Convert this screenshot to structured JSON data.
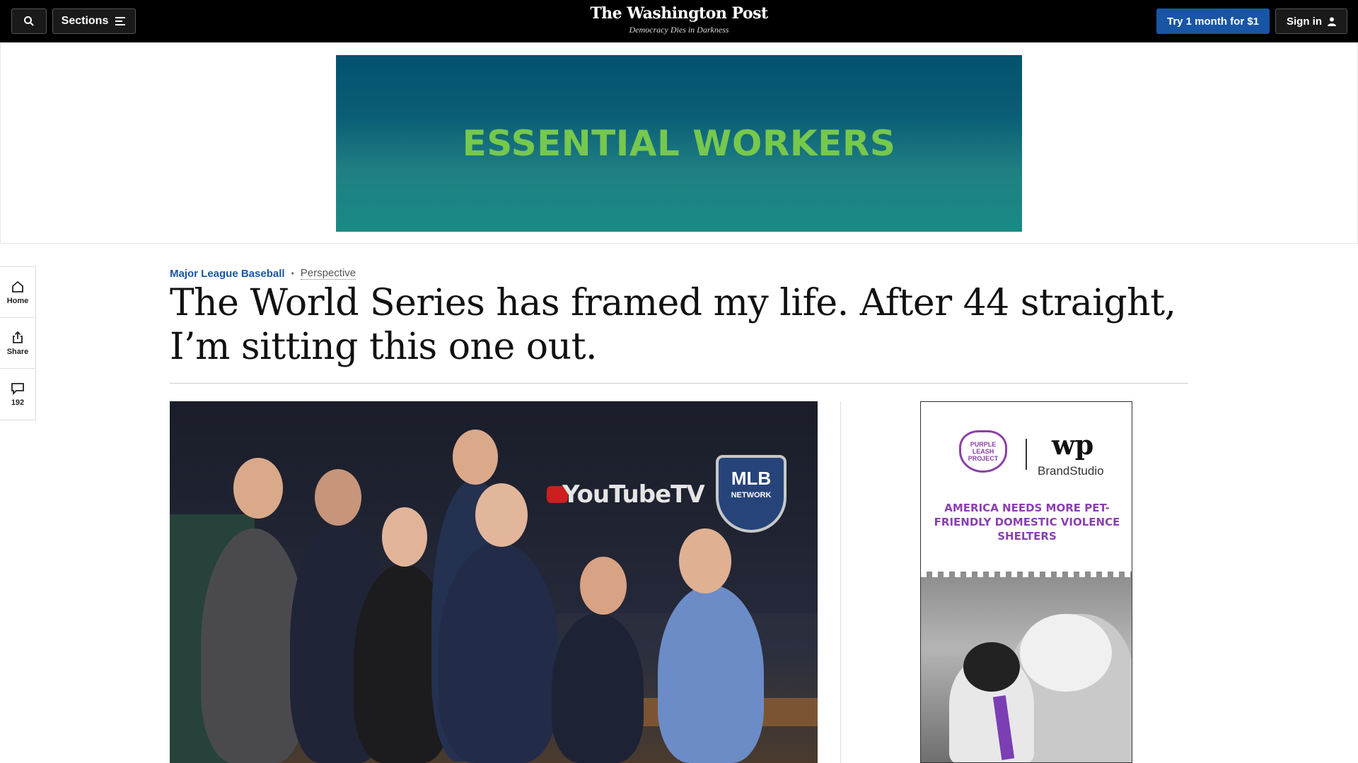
{
  "header": {
    "sections_label": "Sections",
    "logo_name": "The Washington Post",
    "logo_tagline": "Democracy Dies in Darkness",
    "try_label": "Try 1 month for $1",
    "signin_label": "Sign in"
  },
  "top_ad": {
    "headline": "ESSENTIAL WORKERS"
  },
  "rail": {
    "home_label": "Home",
    "share_label": "Share",
    "comments_count": "192"
  },
  "article": {
    "section": "Major League Baseball",
    "label": "Perspective",
    "headline": "The World Series has framed my life. After 44 straight, I’m sitting this one out."
  },
  "photo": {
    "wall_brand": "YouTubeTV",
    "logo_text": "MLB",
    "logo_subtext": "NETWORK"
  },
  "side_ad": {
    "badge_text": "PURPLE LEASH PROJECT",
    "brand_logo": "wp",
    "brand_name": "BrandStudio",
    "message": "AMERICA NEEDS MORE PET-FRIENDLY DOMESTIC VIOLENCE SHELTERS"
  },
  "icons": {
    "search": "search-icon",
    "menu": "menu-icon",
    "user": "user-icon",
    "home": "home-icon",
    "share": "share-icon",
    "comment": "comment-icon"
  },
  "colors": {
    "topbar": "#000000",
    "accent_blue": "#1955a5",
    "ad_green": "#76c84d",
    "ad_purple": "#8a3fb0"
  }
}
